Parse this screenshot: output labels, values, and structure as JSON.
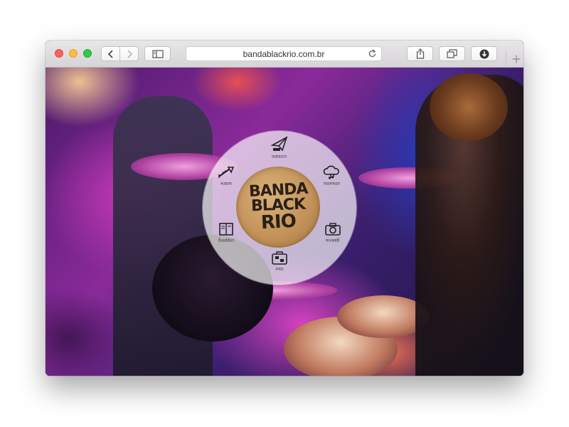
{
  "browser": {
    "url": "bandablackrio.com.br"
  },
  "menu": {
    "items": [
      {
        "id": "contact",
        "label": "contato",
        "icon": "paper-plane-icon"
      },
      {
        "id": "streams",
        "label": "streams",
        "icon": "cloud-music-icon"
      },
      {
        "id": "gallery",
        "label": "galeria",
        "icon": "camera-icon"
      },
      {
        "id": "tour",
        "label": "tour",
        "icon": "suitcase-icon"
      },
      {
        "id": "clipping",
        "label": "clipping",
        "icon": "book-icon"
      },
      {
        "id": "about",
        "label": "sobre",
        "icon": "trumpet-icon"
      }
    ]
  },
  "logo": {
    "line1": "BANDA",
    "line2": "BLACK",
    "line3": "RIO"
  },
  "colors": {
    "close": "#fc605b",
    "minimize": "#fdbc40",
    "zoom": "#34c84a",
    "logo_badge": "#c4935a"
  }
}
